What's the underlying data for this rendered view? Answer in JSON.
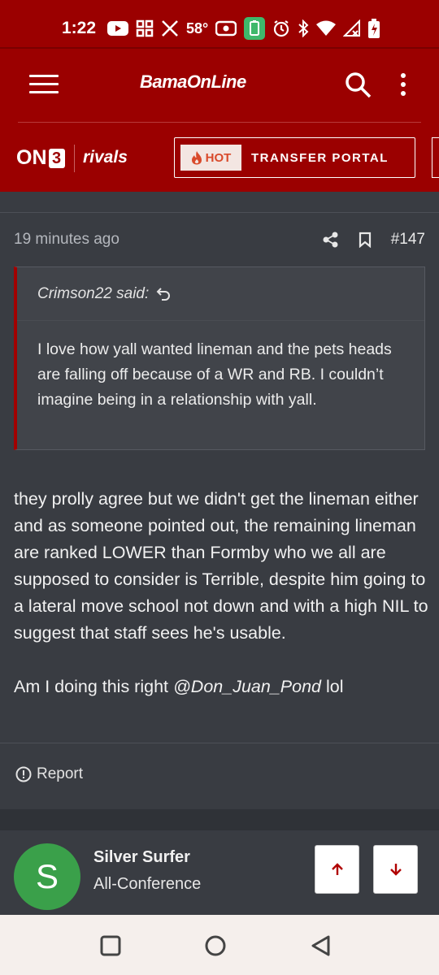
{
  "status_bar": {
    "time": "1:22",
    "temperature": "58°",
    "icons": [
      "youtube-icon",
      "grid-icon",
      "x-icon",
      "temperature",
      "radio-icon",
      "battery-saver-icon",
      "alarm-icon",
      "bluetooth-icon",
      "wifi-icon",
      "signal-icon",
      "battery-icon"
    ]
  },
  "header": {
    "logo_text": "BamaOnLine",
    "on3_text": "ON",
    "on3_digit": "3",
    "rivals_text": "rivals",
    "hot_label": "HOT",
    "transfer_label": "TRANSFER PORTAL",
    "background_color": "#9b0000"
  },
  "post": {
    "timestamp": "19 minutes ago",
    "post_number": "#147",
    "quote": {
      "author_line": "Crimson22 said:",
      "text": "I love how yall wanted lineman and the pets heads are falling off because of a WR and RB. I couldn’t imagine being in a relationship with yall."
    },
    "body_paragraph": "they prolly agree but we didn't get the lineman either and as someone pointed out, the remaining lineman are ranked LOWER than Formby who we all are supposed to consider is Terrible, despite him going to a lateral move school not down and with a high NIL to suggest that staff sees he's usable.",
    "closing_prefix": "Am I doing this right ",
    "mention": "@Don_Juan_Pond",
    "closing_suffix": " lol",
    "report_label": "Report"
  },
  "next_post": {
    "avatar_letter": "S",
    "avatar_color": "#3aa04a",
    "author_name": "Silver Surfer",
    "author_title": "All-Conference"
  }
}
